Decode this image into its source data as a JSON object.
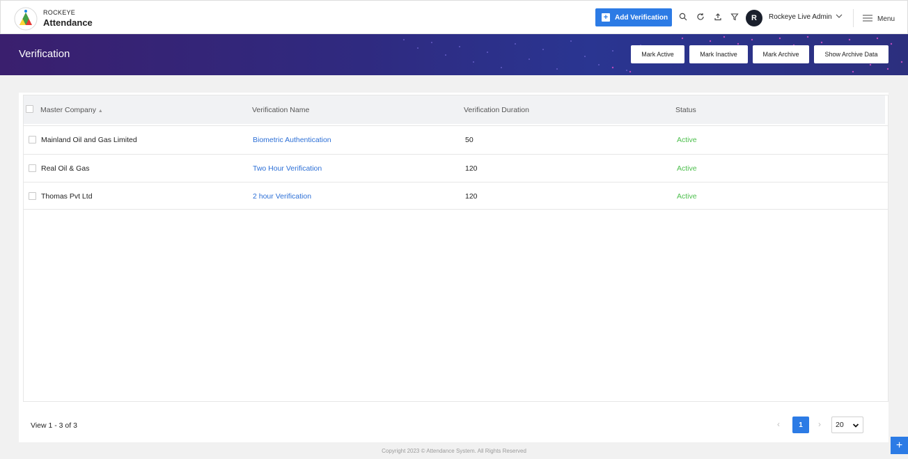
{
  "brand": {
    "top": "ROCKEYE",
    "main": "Attendance"
  },
  "header": {
    "add_button": "Add Verification",
    "user_initial": "R",
    "user_name": "Rockeye Live Admin",
    "menu_label": "Menu"
  },
  "page": {
    "title": "Verification",
    "actions": [
      "Mark Active",
      "Mark Inactive",
      "Mark Archive",
      "Show Archive Data"
    ]
  },
  "table": {
    "columns": [
      "Master Company",
      "Verification Name",
      "Verification Duration",
      "Status"
    ],
    "rows": [
      {
        "company": "Mainland Oil and Gas Limited",
        "name": "Biometric Authentication",
        "duration": "50",
        "status": "Active"
      },
      {
        "company": "Real Oil & Gas",
        "name": "Two Hour Verification",
        "duration": "120",
        "status": "Active"
      },
      {
        "company": "Thomas Pvt Ltd",
        "name": "2 hour Verification",
        "duration": "120",
        "status": "Active"
      }
    ]
  },
  "pagination": {
    "view_text": "View 1 - 3 of 3",
    "current_page": "1",
    "page_size": "20"
  },
  "footer": {
    "copyright": "Copyright 2023 © Attendance System. All Rights Reserved"
  },
  "colors": {
    "primary": "#2c7be5",
    "banner": "#2f2a80",
    "status_active": "#4cbf4c",
    "link": "#2c6fd6"
  }
}
